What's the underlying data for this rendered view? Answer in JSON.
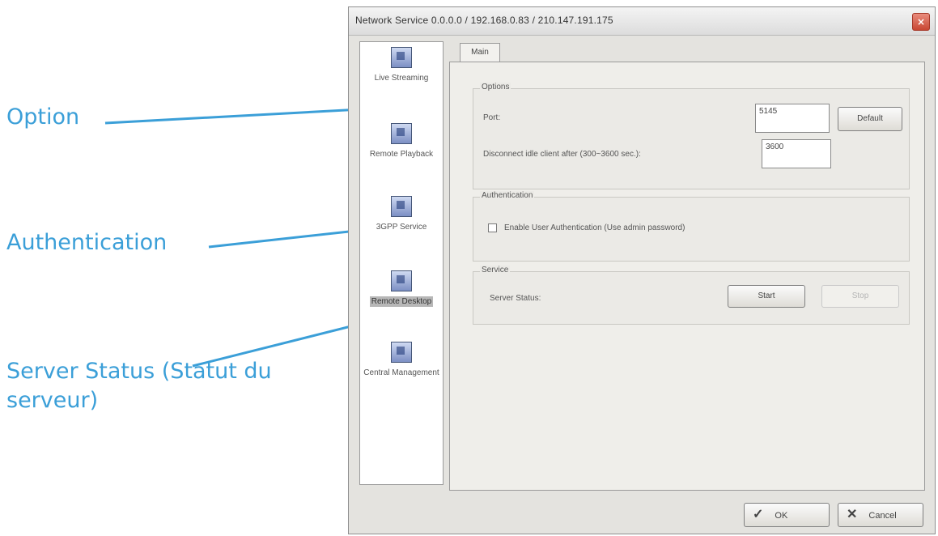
{
  "annotations": {
    "option": "Option",
    "authentication": "Authentication",
    "server_status": "Server Status (Statut du serveur)"
  },
  "dialog": {
    "title": "Network Service   0.0.0.0 / 192.168.0.83 / 210.147.191.175",
    "close_label": "×",
    "nav": [
      {
        "label": "Live Streaming",
        "icon": "live-streaming-icon"
      },
      {
        "label": "Remote Playback",
        "icon": "remote-playback-icon"
      },
      {
        "label": "3GPP Service",
        "icon": "3gpp-service-icon"
      },
      {
        "label": "Remote Desktop",
        "icon": "remote-desktop-icon",
        "selected": true
      },
      {
        "label": "Central Management",
        "icon": "central-management-icon"
      }
    ],
    "tab": "Main",
    "options": {
      "legend": "Options",
      "port_label": "Port:",
      "port_value": "5145",
      "default_button": "Default",
      "disconnect_label": "Disconnect idle client after (300~3600 sec.):",
      "disconnect_value": "3600"
    },
    "authentication": {
      "legend": "Authentication",
      "checkbox_label": "Enable User Authentication (Use admin password)",
      "checked": false
    },
    "service": {
      "legend": "Service",
      "status_label": "Server Status:",
      "start_button": "Start",
      "stop_button": "Stop"
    },
    "footer": {
      "ok_label": "OK",
      "cancel_label": "Cancel"
    }
  },
  "colors": {
    "annotation": "#3b9fd8",
    "dialog_bg": "#e4e3df"
  }
}
